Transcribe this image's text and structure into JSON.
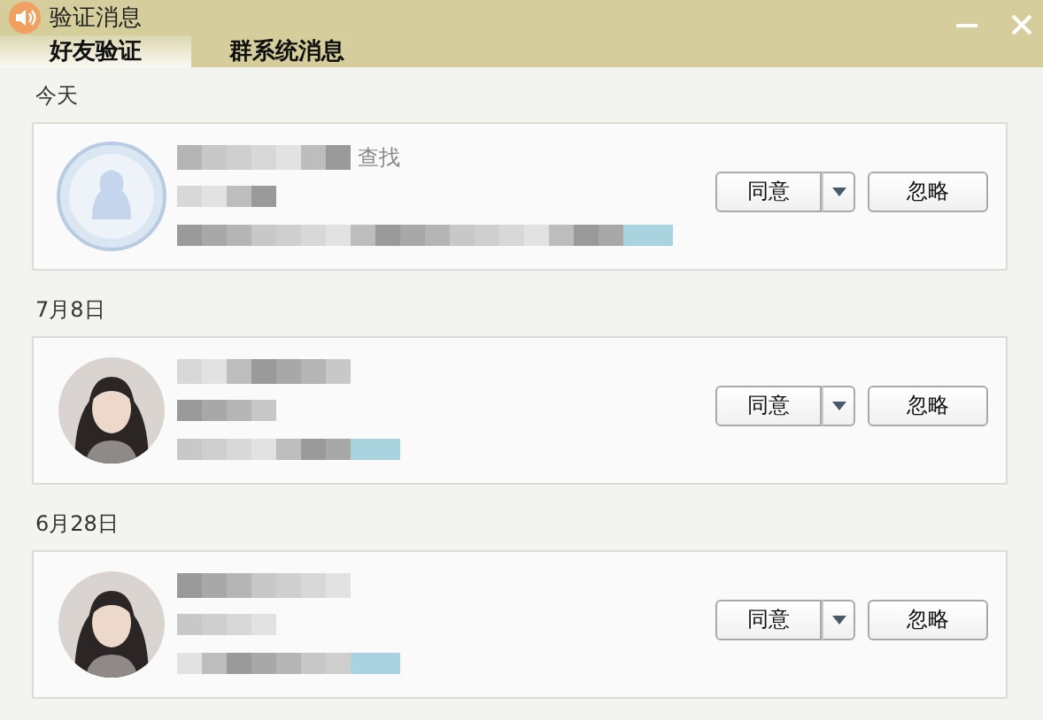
{
  "window": {
    "title": "验证消息"
  },
  "tabs": [
    {
      "label": "好友验证",
      "selected": true
    },
    {
      "label": "群系统消息",
      "selected": false
    }
  ],
  "groups": [
    {
      "date": "今天",
      "requests": [
        {
          "kind": "default",
          "source": "查找",
          "accept": "同意",
          "ignore": "忽略"
        }
      ]
    },
    {
      "date": "7月8日",
      "requests": [
        {
          "kind": "photo",
          "accept": "同意",
          "ignore": "忽略"
        }
      ]
    },
    {
      "date": "6月28日",
      "requests": [
        {
          "kind": "photo",
          "accept": "同意",
          "ignore": "忽略"
        }
      ]
    }
  ]
}
